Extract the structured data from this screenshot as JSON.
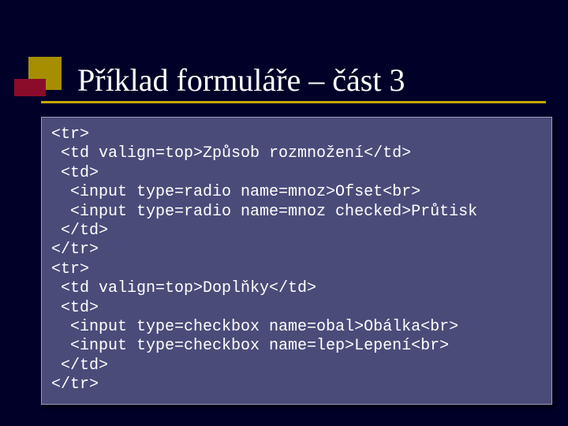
{
  "title": "Příklad formuláře – část 3",
  "code": {
    "l1": "<tr>",
    "l2": " <td valign=top>Způsob rozmnožení</td>",
    "l3": " <td>",
    "l4": "  <input type=radio name=mnoz>Ofset<br>",
    "l5": "  <input type=radio name=mnoz checked>Průtisk",
    "l6": " </td>",
    "l7": "</tr>",
    "l8": "<tr>",
    "l9": " <td valign=top>Doplňky</td>",
    "l10": " <td>",
    "l11": "  <input type=checkbox name=obal>Obálka<br>",
    "l12": "  <input type=checkbox name=lep>Lepení<br>",
    "l13": " </td>",
    "l14": "</tr>"
  }
}
